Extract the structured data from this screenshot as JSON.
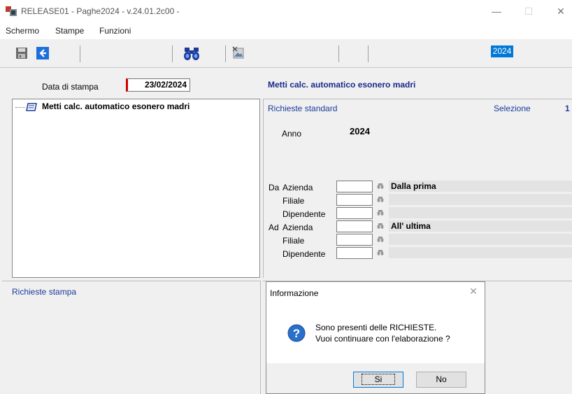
{
  "window": {
    "title": "RELEASE01 - Paghe2024 - v.24.01.2c00 -",
    "minimize": "—",
    "maximize": "☐",
    "close": "✕"
  },
  "menu": {
    "items": [
      "Schermo",
      "Stampe",
      "Funzioni"
    ]
  },
  "toolbar": {
    "year": "2024",
    "icons": [
      "save-icon",
      "back-arrow-icon",
      "binoculars-icon",
      "image-edit-icon"
    ]
  },
  "print": {
    "date_label": "Data di stampa",
    "date_value": "23/02/2024"
  },
  "tree": {
    "item_label": "Metti calc. automatico esonero madri"
  },
  "right": {
    "title": "Metti calc. automatico esonero madri",
    "requests_label": "Richieste standard",
    "selection_label": "Selezione",
    "selection_value": "1",
    "anno_label": "Anno",
    "anno_value": "2024",
    "da_label": "Da",
    "ad_label": "Ad",
    "rows": [
      {
        "label": "Azienda",
        "desc": "Dalla prima"
      },
      {
        "label": "Filiale",
        "desc": ""
      },
      {
        "label": "Dipendente",
        "desc": ""
      },
      {
        "label": "Azienda",
        "desc": "All' ultima"
      },
      {
        "label": "Filiale",
        "desc": ""
      },
      {
        "label": "Dipendente",
        "desc": ""
      }
    ]
  },
  "bottom": {
    "requests_print_label": "Richieste stampa"
  },
  "dialog": {
    "title": "Informazione",
    "message_line1": "Sono presenti delle RICHIESTE.",
    "message_line2": "Vuoi continuare con l'elaborazione ?",
    "yes_label": "Si",
    "no_label": "No"
  },
  "colors": {
    "accent": "#0078d7",
    "label_blue": "#1a3a9a",
    "title_blue": "#1a2a8a",
    "required_red": "#d40000"
  }
}
